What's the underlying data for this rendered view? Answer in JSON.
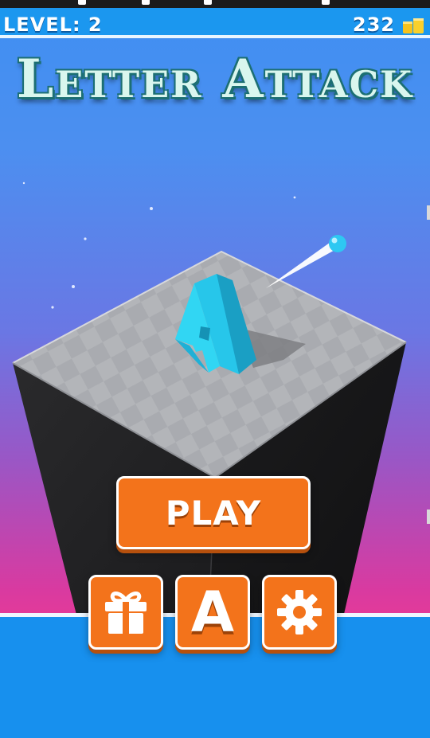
{
  "hud": {
    "level_text": "LEVEL: 2",
    "coins": "232",
    "coin_icon": "coin-stack-icon"
  },
  "title": "Letter Attack",
  "scene": {
    "current_letter": "A",
    "letter_color": "#23c9ea",
    "ball_color": "#2ec8f2"
  },
  "buttons": {
    "play_label": "PLAY",
    "gift_icon": "gift-icon",
    "letter_select": "A",
    "settings_icon": "gear-icon"
  },
  "colors": {
    "accent_orange": "#f3731b",
    "top_bar": "#1b97ef",
    "bottom_band": "#1790ee"
  }
}
